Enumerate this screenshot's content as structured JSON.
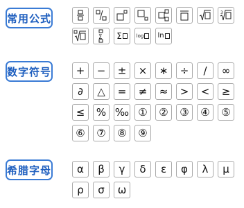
{
  "sections": {
    "common": {
      "label": "常用公式"
    },
    "math": {
      "label": "数字符号"
    },
    "greek": {
      "label": "希腊字母"
    }
  },
  "common_buttons": [
    {
      "icon": "fraction-vertical-icon"
    },
    {
      "icon": "fraction-slash-icon"
    },
    {
      "icon": "superscript-icon"
    },
    {
      "icon": "subscript-icon"
    },
    {
      "icon": "sub-superscript-icon"
    },
    {
      "icon": "overline-icon"
    },
    {
      "icon": "square-root-icon"
    },
    {
      "icon": "cube-root-icon"
    },
    {
      "icon": "nth-root-icon"
    },
    {
      "icon": "summation-limits-icon"
    },
    {
      "icon": "summation-icon",
      "text": "Σ"
    },
    {
      "icon": "logarithm-icon",
      "text": "log"
    },
    {
      "icon": "natural-log-icon",
      "text": "ln"
    }
  ],
  "math_symbols": [
    "+",
    "−",
    "±",
    "×",
    "∗",
    "÷",
    "/",
    "∞",
    "∂",
    "△",
    "=",
    "≠",
    "≈",
    ">",
    "<",
    "≥",
    "≤",
    "%",
    "‰",
    "①",
    "②",
    "③",
    "④",
    "⑤",
    "⑥",
    "⑦",
    "⑧",
    "⑨"
  ],
  "greek_letters": [
    "α",
    "β",
    "γ",
    "δ",
    "ε",
    "φ",
    "λ",
    "μ",
    "ρ",
    "σ",
    "ω"
  ],
  "colors": {
    "accent": "#3a7bd5",
    "label_text": "#1f5fbf",
    "button_border": "#a9a9a9"
  }
}
